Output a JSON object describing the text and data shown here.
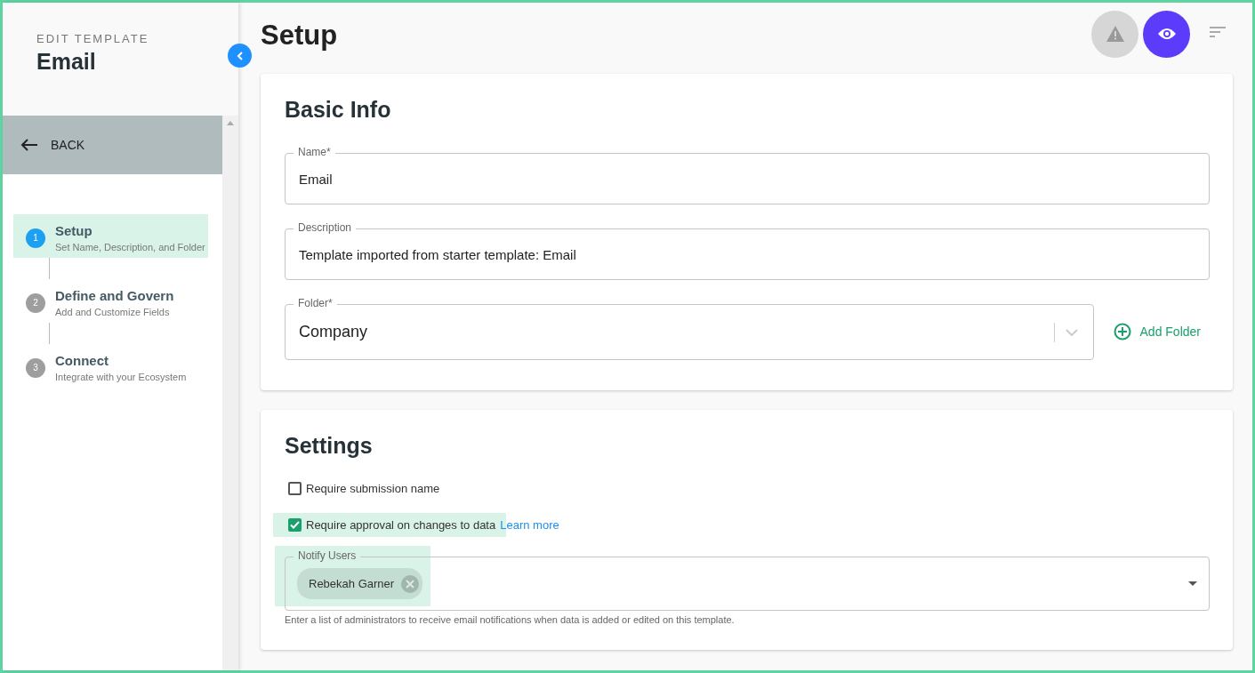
{
  "sidebar": {
    "overline": "EDIT TEMPLATE",
    "title": "Email",
    "back": "BACK",
    "steps": [
      {
        "number": "1",
        "title": "Setup",
        "subtitle": "Set Name, Description, and Folder",
        "selected": true
      },
      {
        "number": "2",
        "title": "Define and Govern",
        "subtitle": "Add and Customize Fields",
        "selected": false
      },
      {
        "number": "3",
        "title": "Connect",
        "subtitle": "Integrate with your Ecosystem",
        "selected": false
      }
    ]
  },
  "page_title": "Setup",
  "basic_info": {
    "heading": "Basic Info",
    "fields": [
      {
        "label": "Name*",
        "value": "Email"
      },
      {
        "label": "Description",
        "value": "Template imported from starter template: Email"
      }
    ],
    "folder": {
      "label": "Folder*",
      "value": "Company"
    },
    "add_folder": "Add Folder"
  },
  "settings": {
    "heading": "Settings",
    "options": [
      {
        "label": "Require submission name",
        "checked": false
      },
      {
        "label": "Require approval on changes to data",
        "checked": true,
        "link": "Learn more"
      }
    ],
    "notify": {
      "label": "Notify Users",
      "highlighted": true,
      "chips": [
        "Rebekah Garner"
      ],
      "helper": "Enter a list of administrators to receive email notifications when data is added or edited on this template."
    }
  }
}
